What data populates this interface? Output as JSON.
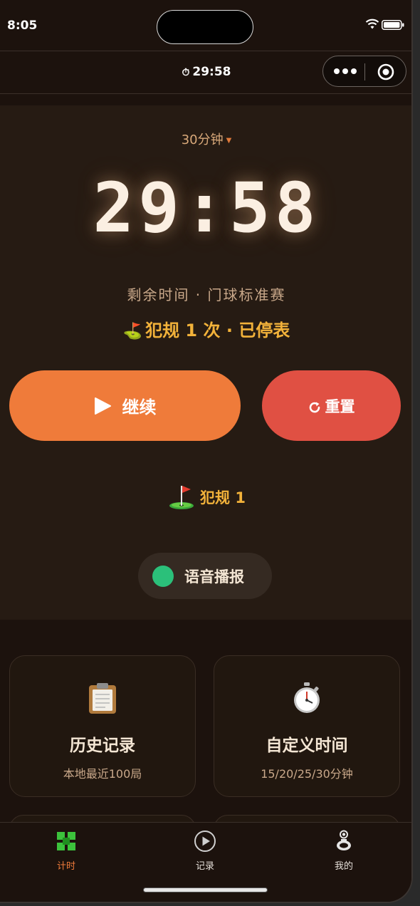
{
  "status_bar": {
    "time": "8:05"
  },
  "nav": {
    "title_icon": "stopwatch-icon",
    "title": "29:58"
  },
  "timer": {
    "duration_label": "30分钟",
    "time_display": "29:58",
    "caption": "剩余时间 · 门球标准赛",
    "status_text": "犯规 1 次 · 已停表"
  },
  "buttons": {
    "continue_label": "继续",
    "reset_label": "重置"
  },
  "foul": {
    "label": "犯规 1"
  },
  "voice": {
    "label": "语音播报",
    "enabled": true
  },
  "cards": [
    {
      "icon": "clipboard-icon",
      "title": "历史记录",
      "subtitle": "本地最近100局"
    },
    {
      "icon": "stopwatch-icon",
      "title": "自定义时间",
      "subtitle": "15/20/25/30分钟"
    }
  ],
  "tabs": [
    {
      "label": "计时",
      "icon": "grid-icon",
      "active": true
    },
    {
      "label": "记录",
      "icon": "play-circle-icon",
      "active": false
    },
    {
      "label": "我的",
      "icon": "person-icon",
      "active": false
    }
  ],
  "colors": {
    "accent_orange": "#ef7b3a",
    "danger_red": "#e05043",
    "warning_gold": "#f2b23a",
    "toggle_green": "#2bc07a",
    "tab_active": "#ef7b3a",
    "tab_inactive": "#e6e0da",
    "background": "#1c120d"
  }
}
